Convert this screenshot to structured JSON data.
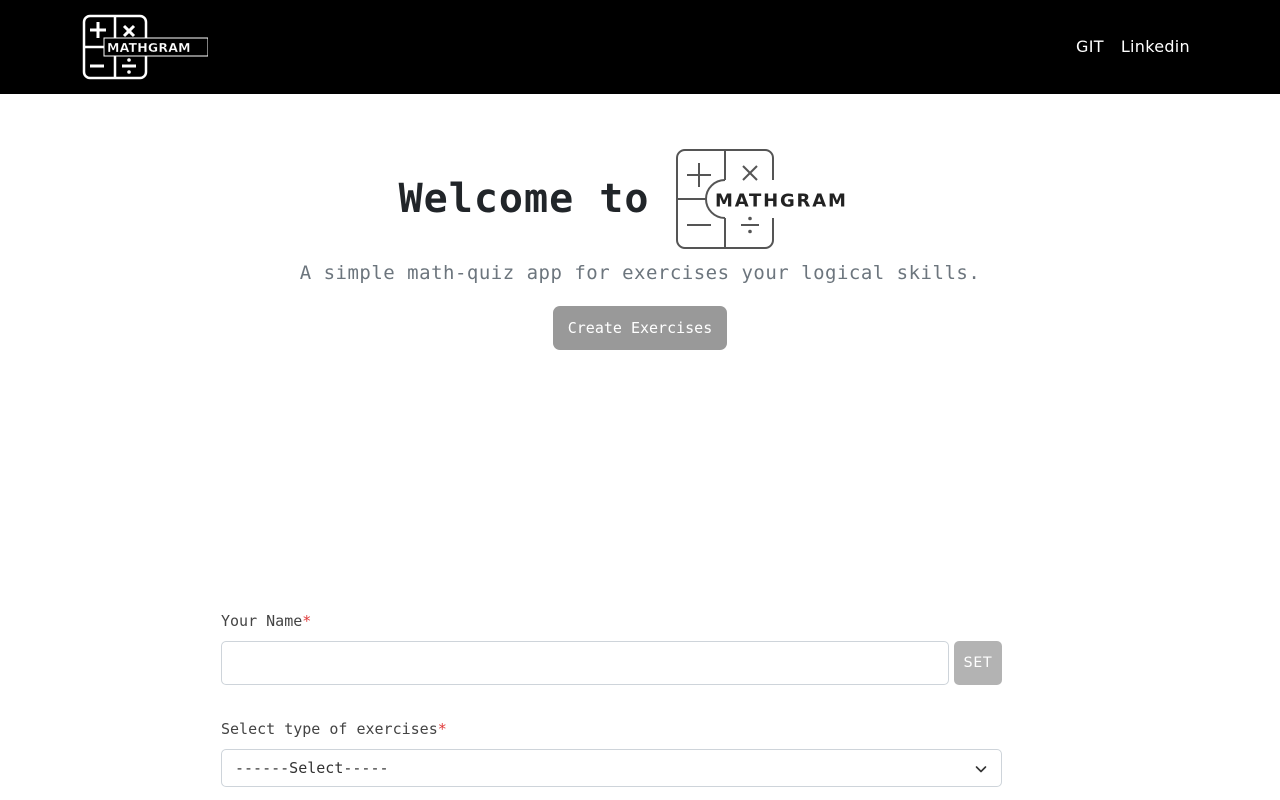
{
  "header": {
    "logo_text": "MATHGRAM",
    "nav": [
      {
        "label": "GIT"
      },
      {
        "label": "Linkedin"
      }
    ]
  },
  "hero": {
    "title": "Welcome to",
    "logo_text": "MATHGRAM",
    "subtitle": "A simple math-quiz app for exercises your logical skills.",
    "cta_label": "Create Exercises"
  },
  "form": {
    "name": {
      "label": "Your Name",
      "required_mark": "*",
      "value": "",
      "button_label": "SET"
    },
    "exercise_type": {
      "label": "Select type of exercises",
      "required_mark": "*",
      "selected": "------Select-----"
    }
  },
  "colors": {
    "header_bg": "#000000",
    "cta_bg": "#999999",
    "set_btn_bg": "#b3b3b3",
    "required": "#e03b3b"
  },
  "icons": [
    "mathgram-logo-icon",
    "chevron-down-icon"
  ]
}
